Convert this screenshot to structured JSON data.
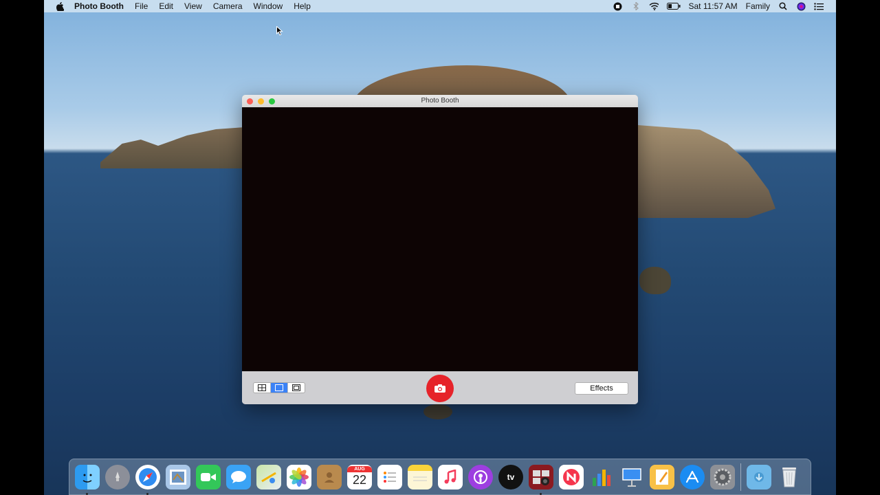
{
  "menubar": {
    "app_name": "Photo Booth",
    "menus": [
      "File",
      "Edit",
      "View",
      "Camera",
      "Window",
      "Help"
    ],
    "clock": "Sat 11:57 AM",
    "user": "Family"
  },
  "window": {
    "title": "Photo Booth",
    "effects_label": "Effects",
    "view_modes": [
      "four-up",
      "single",
      "movie"
    ],
    "active_view_mode": "single"
  },
  "dock": {
    "calendar_month": "AUG",
    "calendar_day": "22",
    "tv_label": "tv",
    "apps": [
      "Finder",
      "Launchpad",
      "Safari",
      "Mail",
      "FaceTime",
      "Messages",
      "Maps",
      "Photos",
      "Contacts",
      "Calendar",
      "Reminders",
      "Notes",
      "Music",
      "Podcasts",
      "TV",
      "Photo Booth",
      "News",
      "Numbers",
      "Keynote",
      "Pages",
      "App Store",
      "System Preferences",
      "Downloads",
      "Trash"
    ]
  },
  "colors": {
    "shutter": "#e6232a",
    "accent": "#3b82f6"
  }
}
